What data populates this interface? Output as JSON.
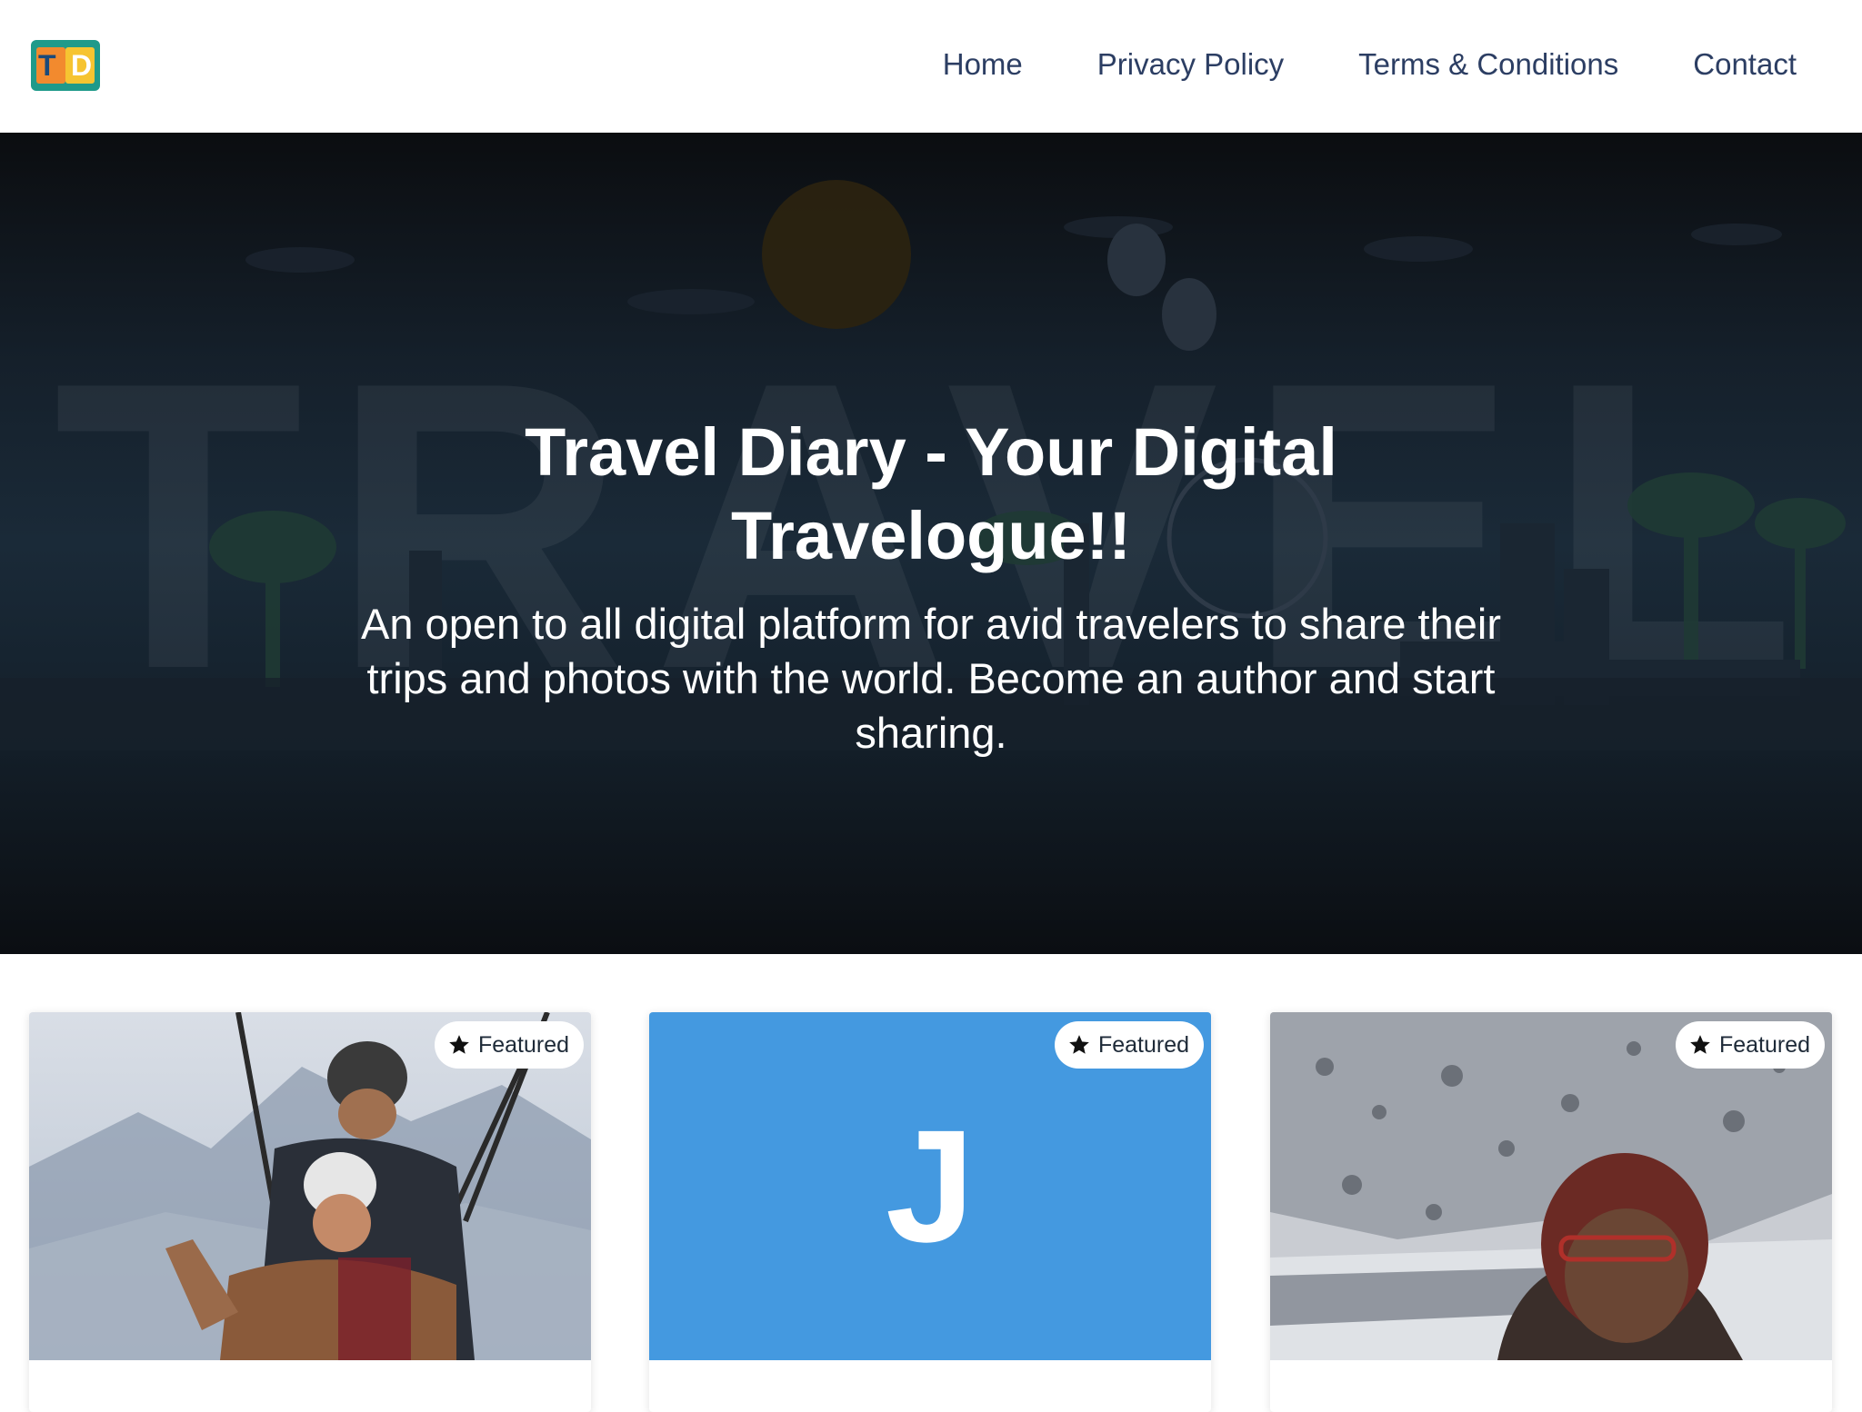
{
  "brand": {
    "logo_letters": [
      "T",
      "D"
    ],
    "colors": {
      "teal": "#1f9a8a",
      "orange": "#f28a2e",
      "yellow": "#f6c431"
    }
  },
  "nav": {
    "items": [
      {
        "label": "Home"
      },
      {
        "label": "Privacy Policy"
      },
      {
        "label": "Terms & Conditions"
      },
      {
        "label": "Contact"
      }
    ]
  },
  "hero": {
    "title": "Travel Diary - Your Digital Travelogue!!",
    "subtitle": "An open to all digital platform for avid travelers to share their trips and photos with the world. Become an author and start sharing.",
    "background_word": "TRAVEL"
  },
  "cards": [
    {
      "badge": "Featured",
      "media": "paragliding-photo"
    },
    {
      "badge": "Featured",
      "media": "author-initial",
      "initial": "J",
      "color": "#4499e0"
    },
    {
      "badge": "Featured",
      "media": "snow-mountain-selfie"
    }
  ],
  "icons": {
    "badge": "star-icon"
  }
}
